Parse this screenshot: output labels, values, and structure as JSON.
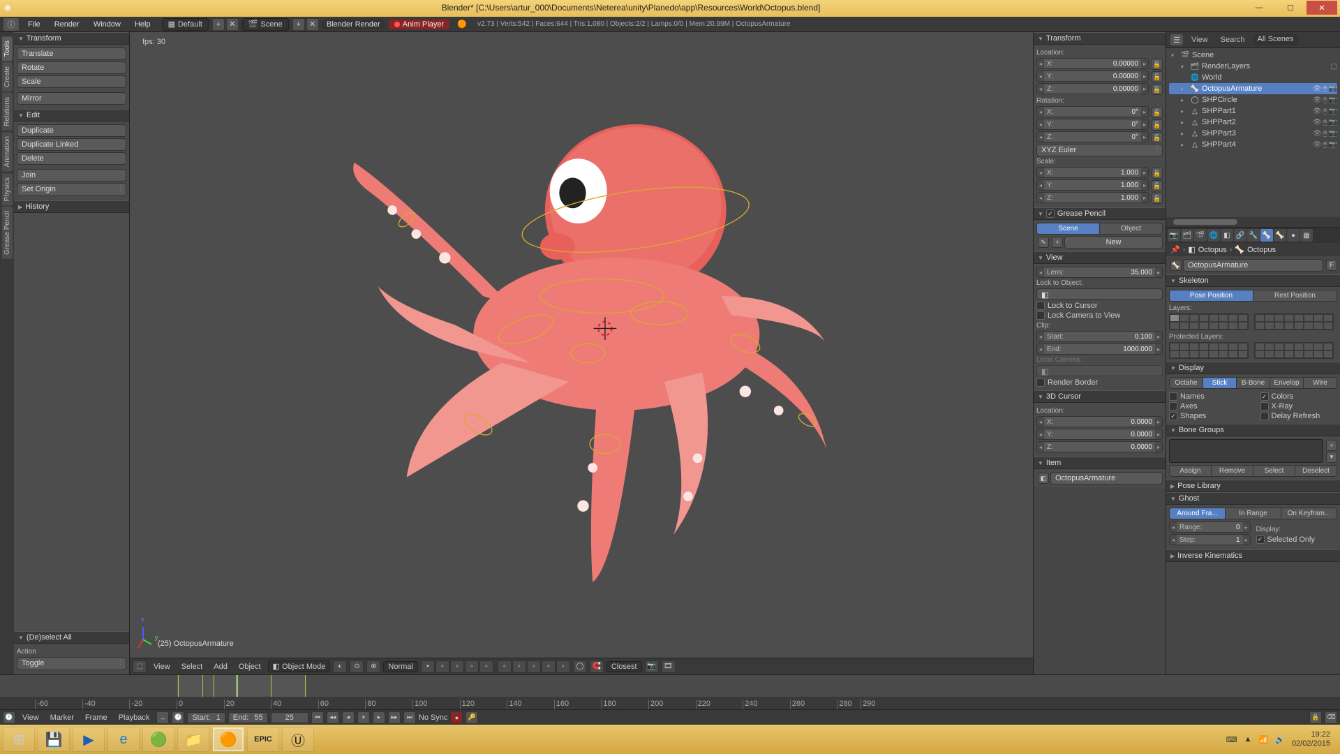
{
  "titlebar": {
    "text": "Blender* [C:\\Users\\artur_000\\Documents\\Neterea\\unity\\Planedo\\app\\Resources\\World\\Octopus.blend]"
  },
  "topmenu": {
    "items": [
      "File",
      "Render",
      "Window",
      "Help"
    ],
    "layout": "Default",
    "scene": "Scene",
    "engine": "Blender Render",
    "anim_player": "Anim Player",
    "stats": "v2.73 | Verts:542 | Faces:644 | Tris:1,080 | Objects:2/2 | Lamps:0/0 | Mem:20.99M | OctopusArmature"
  },
  "left_tabs": [
    "Tools",
    "Create",
    "Relations",
    "Animation",
    "Physics",
    "Grease Pencil"
  ],
  "tool_panel": {
    "transform": {
      "title": "Transform",
      "buttons": [
        "Translate",
        "Rotate",
        "Scale"
      ],
      "mirror": "Mirror"
    },
    "edit": {
      "title": "Edit",
      "buttons": [
        "Duplicate",
        "Duplicate Linked",
        "Delete"
      ],
      "join": "Join",
      "set_origin": "Set Origin"
    },
    "history": {
      "title": "History"
    },
    "deselect": {
      "title": "(De)select All",
      "action_lbl": "Action",
      "toggle": "Toggle"
    }
  },
  "viewport": {
    "fps": "fps: 30",
    "object": "(25) OctopusArmature",
    "footer": {
      "menus": [
        "View",
        "Select",
        "Add",
        "Object"
      ],
      "mode": "Object Mode",
      "shading": "Normal",
      "snap": "Closest"
    }
  },
  "props_n": {
    "transform": {
      "title": "Transform",
      "loc_lbl": "Location:",
      "x": "0.00000",
      "y": "0.00000",
      "z": "0.00000",
      "rot_lbl": "Rotation:",
      "rx": "0°",
      "ry": "0°",
      "rz": "0°",
      "rot_mode": "XYZ Euler",
      "scale_lbl": "Scale:",
      "sx": "1.000",
      "sy": "1.000",
      "sz": "1.000"
    },
    "gp": {
      "title": "Grease Pencil",
      "scene": "Scene",
      "object": "Object",
      "new": "New"
    },
    "view": {
      "title": "View",
      "lens_lbl": "Lens:",
      "lens": "35.000",
      "lock_obj_lbl": "Lock to Object:",
      "lock_cursor": "Lock to Cursor",
      "lock_camera": "Lock Camera to View",
      "clip_lbl": "Clip:",
      "start_lbl": "Start:",
      "start": "0.100",
      "end_lbl": "End:",
      "end": "1000.000",
      "local_cam": "Local Camera:",
      "render_border": "Render Border"
    },
    "cursor": {
      "title": "3D Cursor",
      "loc_lbl": "Location:",
      "x": "0.0000",
      "y": "0.0000",
      "z": "0.0000"
    },
    "item": {
      "title": "Item",
      "name": "OctopusArmature"
    }
  },
  "outliner": {
    "tabs": [
      "View",
      "Search"
    ],
    "dropdown": "All Scenes",
    "tree": [
      {
        "depth": 0,
        "icon": "🎬",
        "label": "Scene",
        "expand": "▾"
      },
      {
        "depth": 1,
        "icon": "🗂",
        "label": "RenderLayers",
        "expand": "▾",
        "icons": [
          "▢"
        ]
      },
      {
        "depth": 1,
        "icon": "🌐",
        "label": "World",
        "expand": ""
      },
      {
        "depth": 1,
        "icon": "🦴",
        "label": "OctopusArmature",
        "expand": "▸",
        "selected": true,
        "icons": [
          "👁",
          "🖱",
          "📷"
        ]
      },
      {
        "depth": 1,
        "icon": "◯",
        "label": "SHPCircle",
        "expand": "▸",
        "icons": [
          "👁",
          "🖱",
          "📷"
        ]
      },
      {
        "depth": 1,
        "icon": "△",
        "label": "SHPPart1",
        "expand": "▸",
        "icons": [
          "👁",
          "🖱",
          "📷"
        ]
      },
      {
        "depth": 1,
        "icon": "△",
        "label": "SHPPart2",
        "expand": "▸",
        "icons": [
          "👁",
          "🖱",
          "📷"
        ]
      },
      {
        "depth": 1,
        "icon": "△",
        "label": "SHPPart3",
        "expand": "▸",
        "icons": [
          "👁",
          "🖱",
          "📷"
        ]
      },
      {
        "depth": 1,
        "icon": "△",
        "label": "SHPPart4",
        "expand": "▸",
        "icons": [
          "👁",
          "🖱",
          "📷"
        ]
      }
    ]
  },
  "props": {
    "breadcrumb": [
      "Octopus",
      "Octopus"
    ],
    "armature_name": "OctopusArmature",
    "field_suffix": "F",
    "skeleton": {
      "title": "Skeleton",
      "pose": "Pose Position",
      "rest": "Rest Position",
      "layers_lbl": "Layers:",
      "protected_lbl": "Protected Layers:"
    },
    "display": {
      "title": "Display",
      "modes": [
        "Octahe",
        "Stick",
        "B-Bone",
        "Envelop",
        "Wire"
      ],
      "active_mode": 1,
      "checks_left": [
        "Names",
        "Axes",
        "Shapes"
      ],
      "checks_right": [
        "Colors",
        "X-Ray",
        "Delay Refresh"
      ],
      "checked": [
        "Shapes",
        "Colors"
      ]
    },
    "bone_groups": {
      "title": "Bone Groups",
      "buttons": [
        "Assign",
        "Remove",
        "Select",
        "Deselect"
      ]
    },
    "pose_lib": "Pose Library",
    "ghost": {
      "title": "Ghost",
      "modes": [
        "Around Fra...",
        "In Range",
        "On Keyfram..."
      ],
      "range_lbl": "Range:",
      "range": "0",
      "step_lbl": "Step:",
      "step": "1",
      "display_lbl": "Display:",
      "selected_only": "Selected Only"
    },
    "ik": "Inverse Kinematics"
  },
  "timeline": {
    "ticks": [
      -60,
      -40,
      -20,
      0,
      20,
      40,
      60,
      80,
      100,
      120,
      140,
      160,
      180,
      200,
      220,
      240,
      260,
      280,
      290
    ],
    "footer": {
      "menus": [
        "View",
        "Marker",
        "Frame",
        "Playback"
      ],
      "start_lbl": "Start:",
      "start": "1",
      "end_lbl": "End:",
      "end": "55",
      "current": "25",
      "sync": "No Sync"
    }
  },
  "taskbar": {
    "clock": "19:22",
    "date": "02/02/2015"
  }
}
